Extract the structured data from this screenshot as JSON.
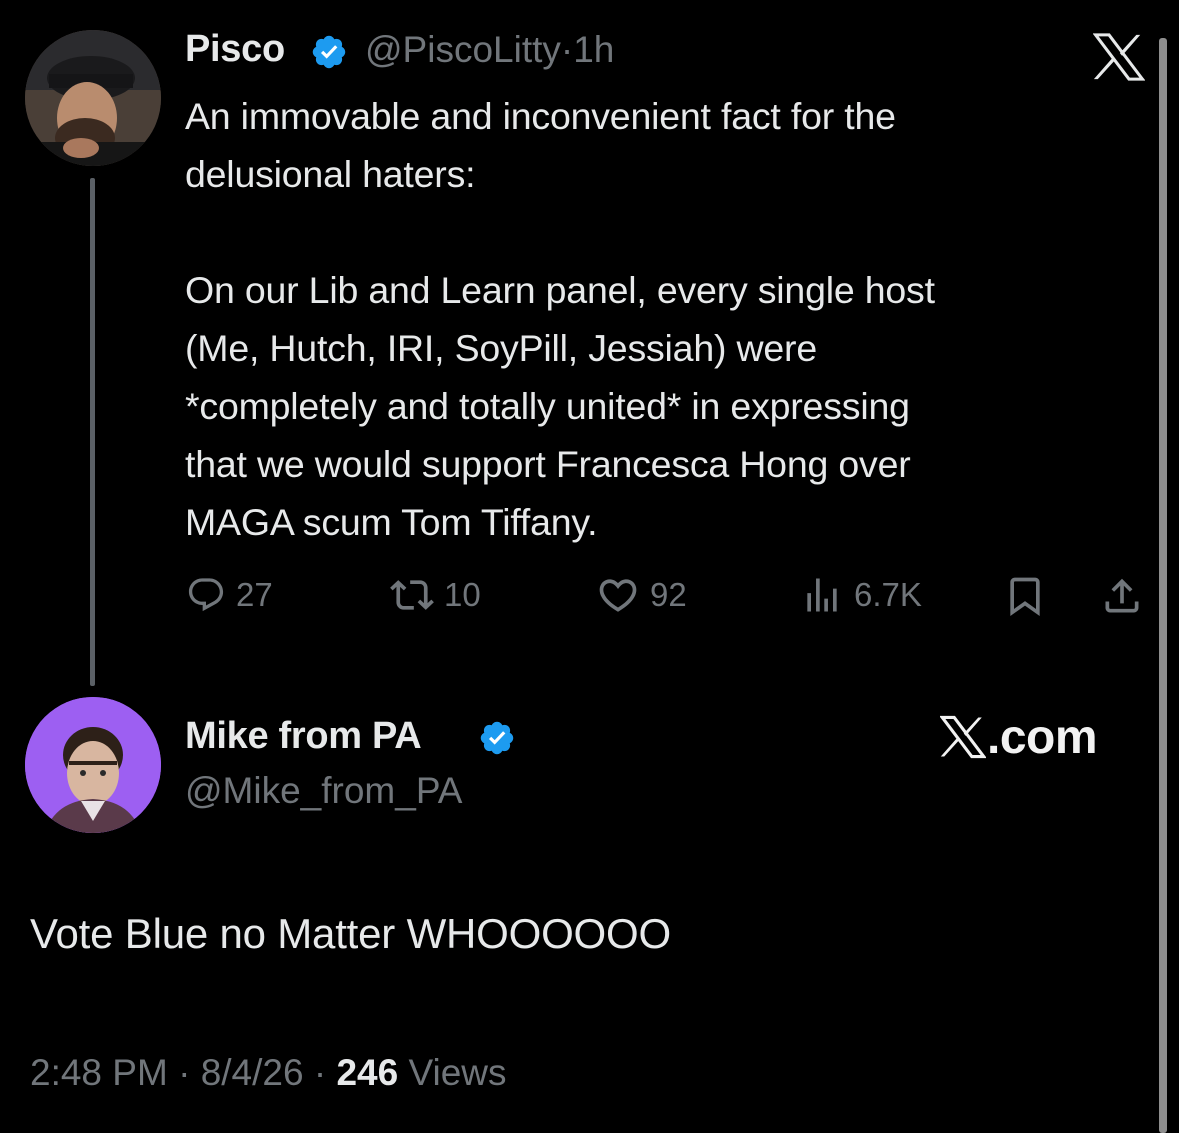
{
  "original_tweet": {
    "author_name": "Pisco",
    "handle": "@PiscoLitty",
    "separator": "·",
    "time": "1h",
    "text": "An immovable and inconvenient fact for the\ndelusional haters:\n\nOn our Lib and Learn panel, every single host\n(Me, Hutch, IRI, SoyPill, Jessiah) were\n*completely and totally united* in expressing\nthat we would support Francesca Hong over\nMAGA scum Tom Tiffany.",
    "actions": {
      "replies": "27",
      "reposts": "10",
      "likes": "92",
      "views": "6.7K"
    },
    "verified_color": "#1d9bf0"
  },
  "reply_tweet": {
    "author_name": "Mike from PA",
    "handle": "@Mike_from_PA",
    "text": "Vote Blue no Matter WHOOOOOO",
    "time": "2:48 PM",
    "date": "8/4/26",
    "separator": "·",
    "views_count": "246",
    "views_label": "Views"
  },
  "branding": {
    "watermark": ".com"
  },
  "icons": [
    "x-logo-icon",
    "verified-badge-icon",
    "reply-icon",
    "repost-icon",
    "like-icon",
    "views-icon",
    "bookmark-icon",
    "share-icon"
  ]
}
